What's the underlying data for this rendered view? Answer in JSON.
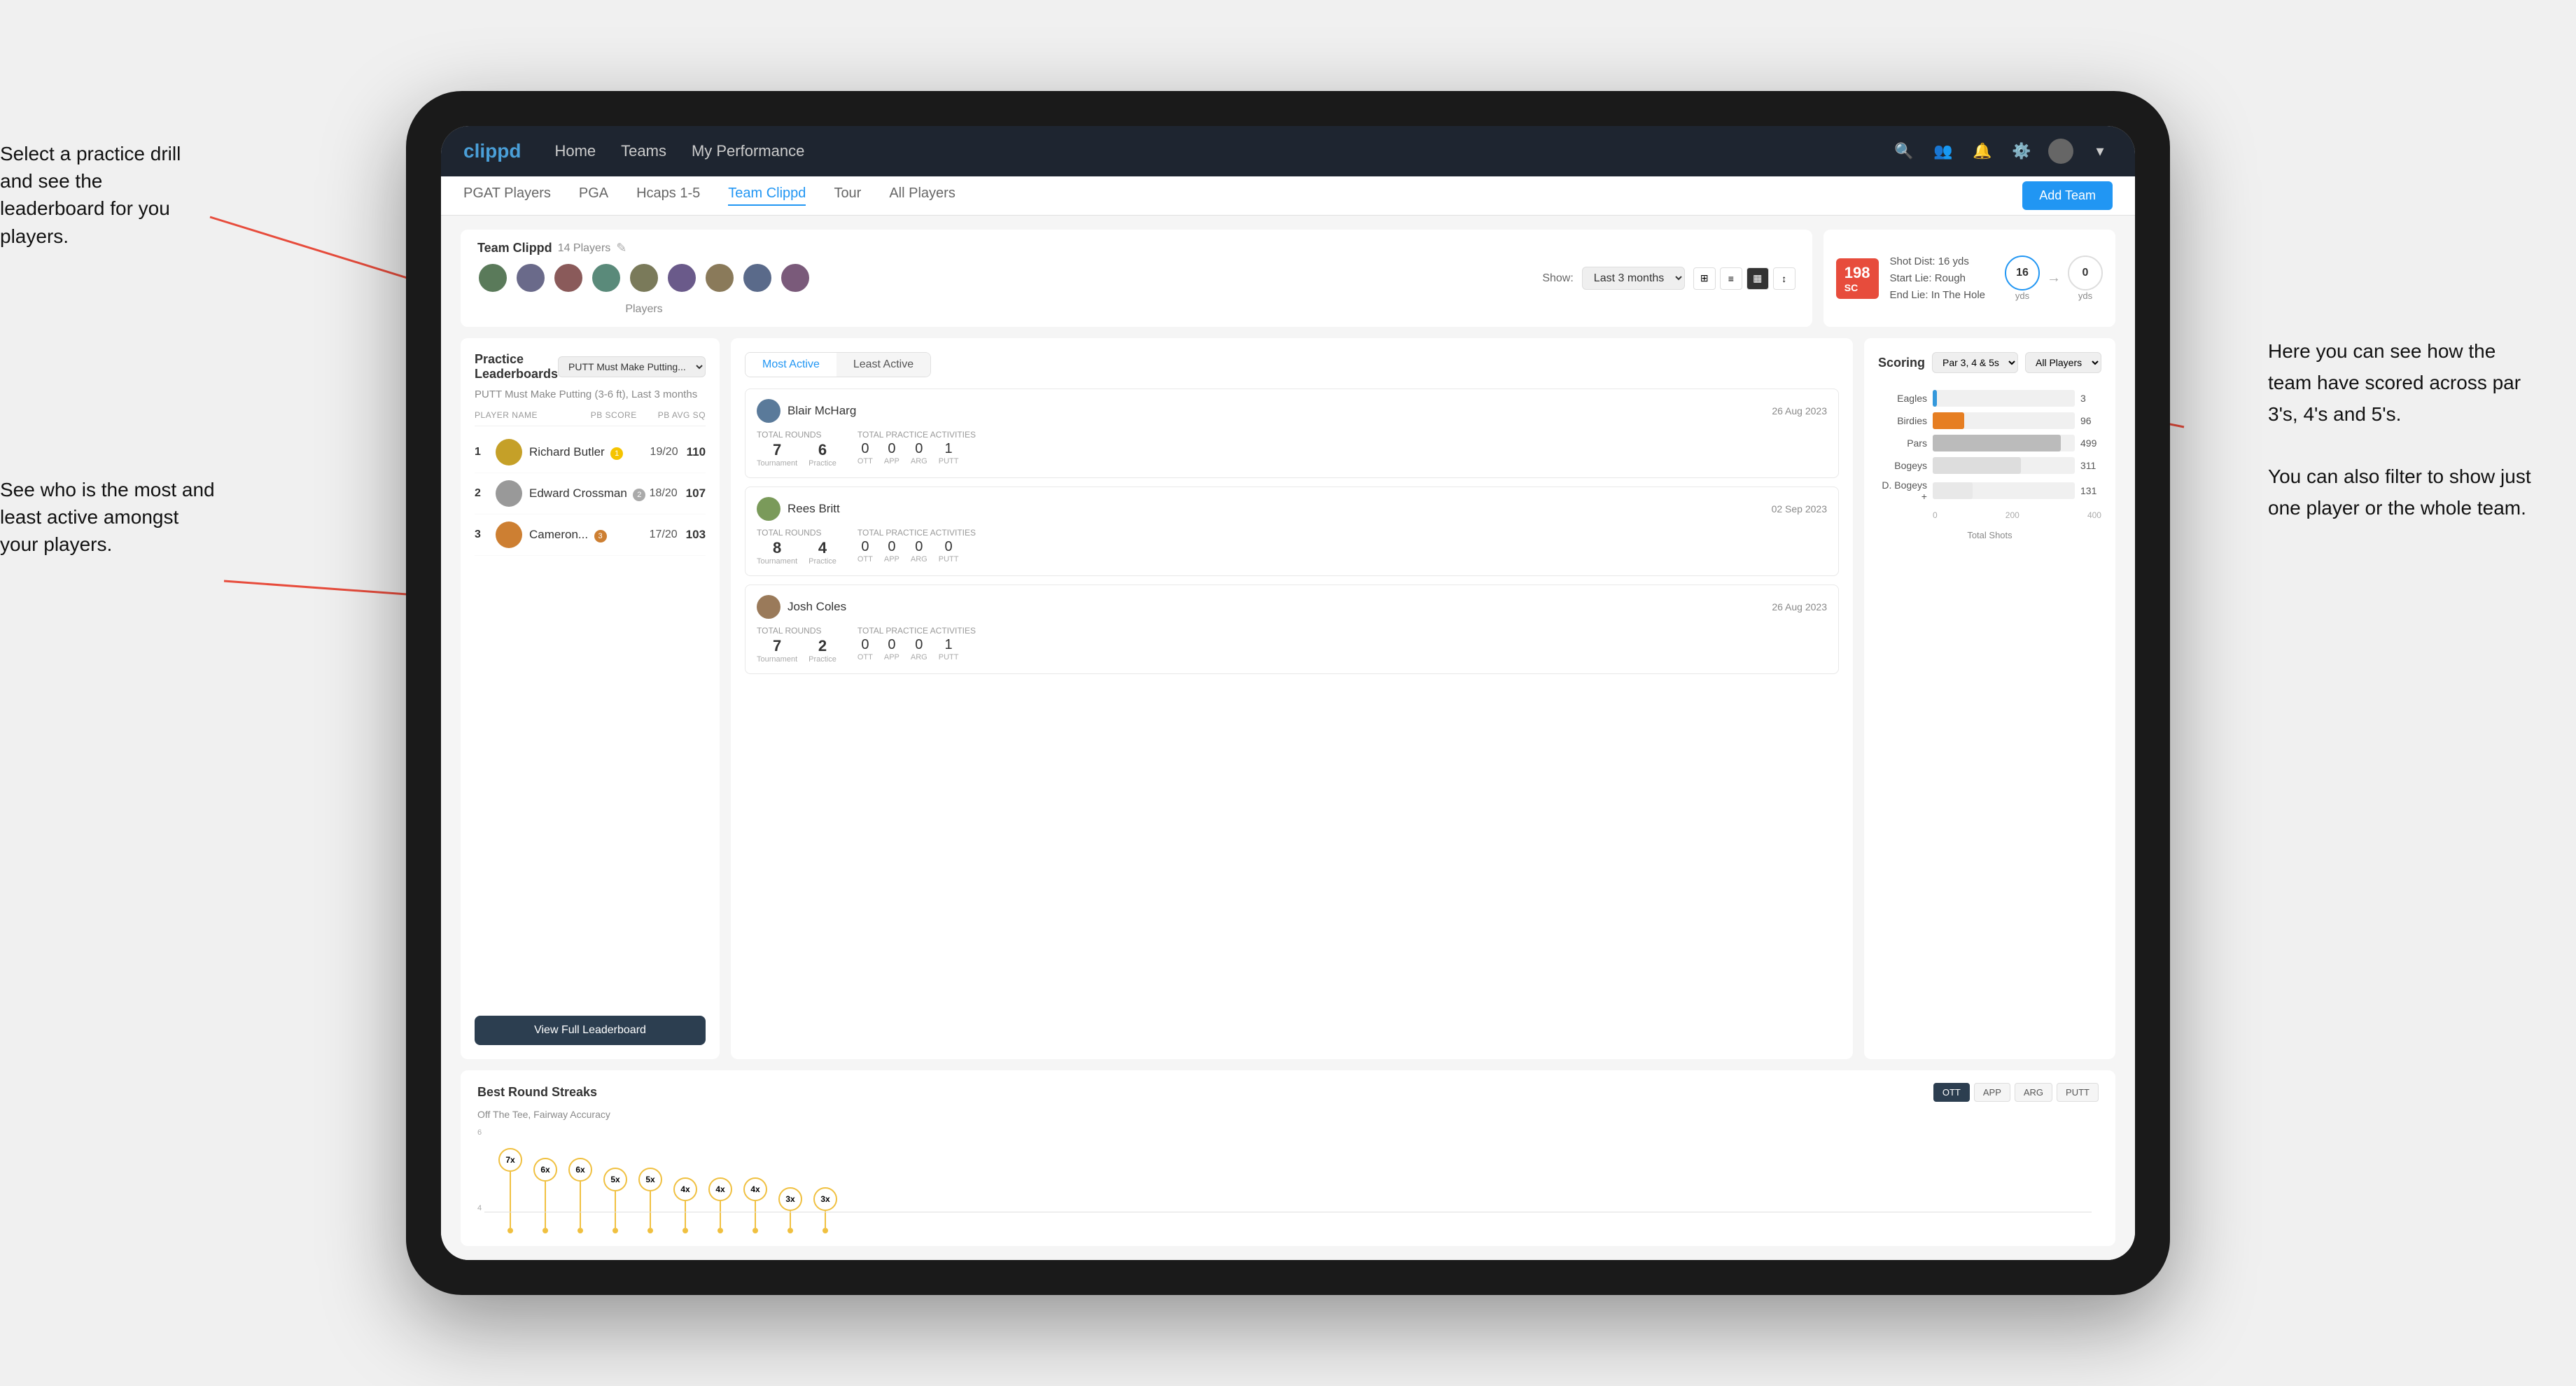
{
  "annotations": {
    "top_left": "Select a practice drill and see the leaderboard for you players.",
    "bottom_left": "See who is the most and least active amongst your players.",
    "right": "Here you can see how the team have scored across par 3's, 4's and 5's.\n\nYou can also filter to show just one player or the whole team."
  },
  "nav": {
    "logo": "clippd",
    "items": [
      "Home",
      "Teams",
      "My Performance"
    ],
    "icons": [
      "search",
      "people",
      "bell",
      "settings",
      "avatar"
    ]
  },
  "subnav": {
    "items": [
      "PGAT Players",
      "PGA",
      "Hcaps 1-5",
      "Team Clippd",
      "Tour",
      "All Players"
    ],
    "active": "Team Clippd",
    "add_team": "Add Team"
  },
  "team_header": {
    "title": "Team Clippd",
    "count": "14 Players",
    "show_label": "Show:",
    "show_value": "Last 3 months",
    "players_label": "Players"
  },
  "shot_info": {
    "badge": "198",
    "badge_sub": "SC",
    "detail1": "Shot Dist: 16 yds",
    "detail2": "Start Lie: Rough",
    "detail3": "End Lie: In The Hole",
    "circle1_value": "16",
    "circle1_label": "yds",
    "circle2_value": "0",
    "circle2_label": "yds"
  },
  "practice_leaderboards": {
    "title": "Practice Leaderboards",
    "drill": "PUTT Must Make Putting...",
    "subtitle": "PUTT Must Make Putting (3-6 ft),",
    "period": "Last 3 months",
    "headers": [
      "PLAYER NAME",
      "PB SCORE",
      "PB AVG SQ"
    ],
    "players": [
      {
        "rank": 1,
        "name": "Richard Butler",
        "score": "19/20",
        "sq": "110",
        "badge_level": 1
      },
      {
        "rank": 2,
        "name": "Edward Crossman",
        "score": "18/20",
        "sq": "107",
        "badge_level": 2
      },
      {
        "rank": 3,
        "name": "Cameron...",
        "score": "17/20",
        "sq": "103",
        "badge_level": 3
      }
    ],
    "view_full": "View Full Leaderboard"
  },
  "activity": {
    "tabs": [
      "Most Active",
      "Least Active"
    ],
    "active_tab": "Most Active",
    "players": [
      {
        "name": "Blair McHarg",
        "date": "26 Aug 2023",
        "total_rounds_label": "Total Rounds",
        "tournament": "7",
        "practice": "6",
        "practice_activities_label": "Total Practice Activities",
        "ott": "0",
        "app": "0",
        "arg": "0",
        "putt": "1"
      },
      {
        "name": "Rees Britt",
        "date": "02 Sep 2023",
        "total_rounds_label": "Total Rounds",
        "tournament": "8",
        "practice": "4",
        "practice_activities_label": "Total Practice Activities",
        "ott": "0",
        "app": "0",
        "arg": "0",
        "putt": "0"
      },
      {
        "name": "Josh Coles",
        "date": "26 Aug 2023",
        "total_rounds_label": "Total Rounds",
        "tournament": "7",
        "practice": "2",
        "practice_activities_label": "Total Practice Activities",
        "ott": "0",
        "app": "0",
        "arg": "0",
        "putt": "1"
      }
    ]
  },
  "scoring": {
    "title": "Scoring",
    "par_filter": "Par 3, 4 & 5s",
    "player_filter": "All Players",
    "bars": [
      {
        "label": "Eagles",
        "value": 3,
        "pct": 3,
        "color": "#3498db"
      },
      {
        "label": "Birdies",
        "value": 96,
        "pct": 25,
        "color": "#e67e22"
      },
      {
        "label": "Pars",
        "value": 499,
        "pct": 90,
        "color": "#bbb"
      },
      {
        "label": "Bogeys",
        "value": 311,
        "pct": 62,
        "color": "#ddd"
      },
      {
        "label": "D. Bogeys +",
        "value": 131,
        "pct": 30,
        "color": "#eee"
      }
    ],
    "x_axis": [
      "0",
      "200",
      "400"
    ],
    "total_shots": "Total Shots"
  },
  "streaks": {
    "title": "Best Round Streaks",
    "subtitle": "Off The Tee, Fairway Accuracy",
    "filter_btns": [
      "OTT",
      "APP",
      "ARG",
      "PUTT"
    ],
    "active_filter": "OTT",
    "pins": [
      {
        "label": "7x",
        "height": 120
      },
      {
        "label": "6x",
        "height": 100
      },
      {
        "label": "6x",
        "height": 100
      },
      {
        "label": "5x",
        "height": 80
      },
      {
        "label": "5x",
        "height": 80
      },
      {
        "label": "4x",
        "height": 60
      },
      {
        "label": "4x",
        "height": 60
      },
      {
        "label": "4x",
        "height": 60
      },
      {
        "label": "3x",
        "height": 40
      },
      {
        "label": "3x",
        "height": 40
      }
    ]
  },
  "colors": {
    "primary": "#2196f3",
    "dark_nav": "#1e2530",
    "accent": "#f5c400",
    "danger": "#e74c3c"
  }
}
